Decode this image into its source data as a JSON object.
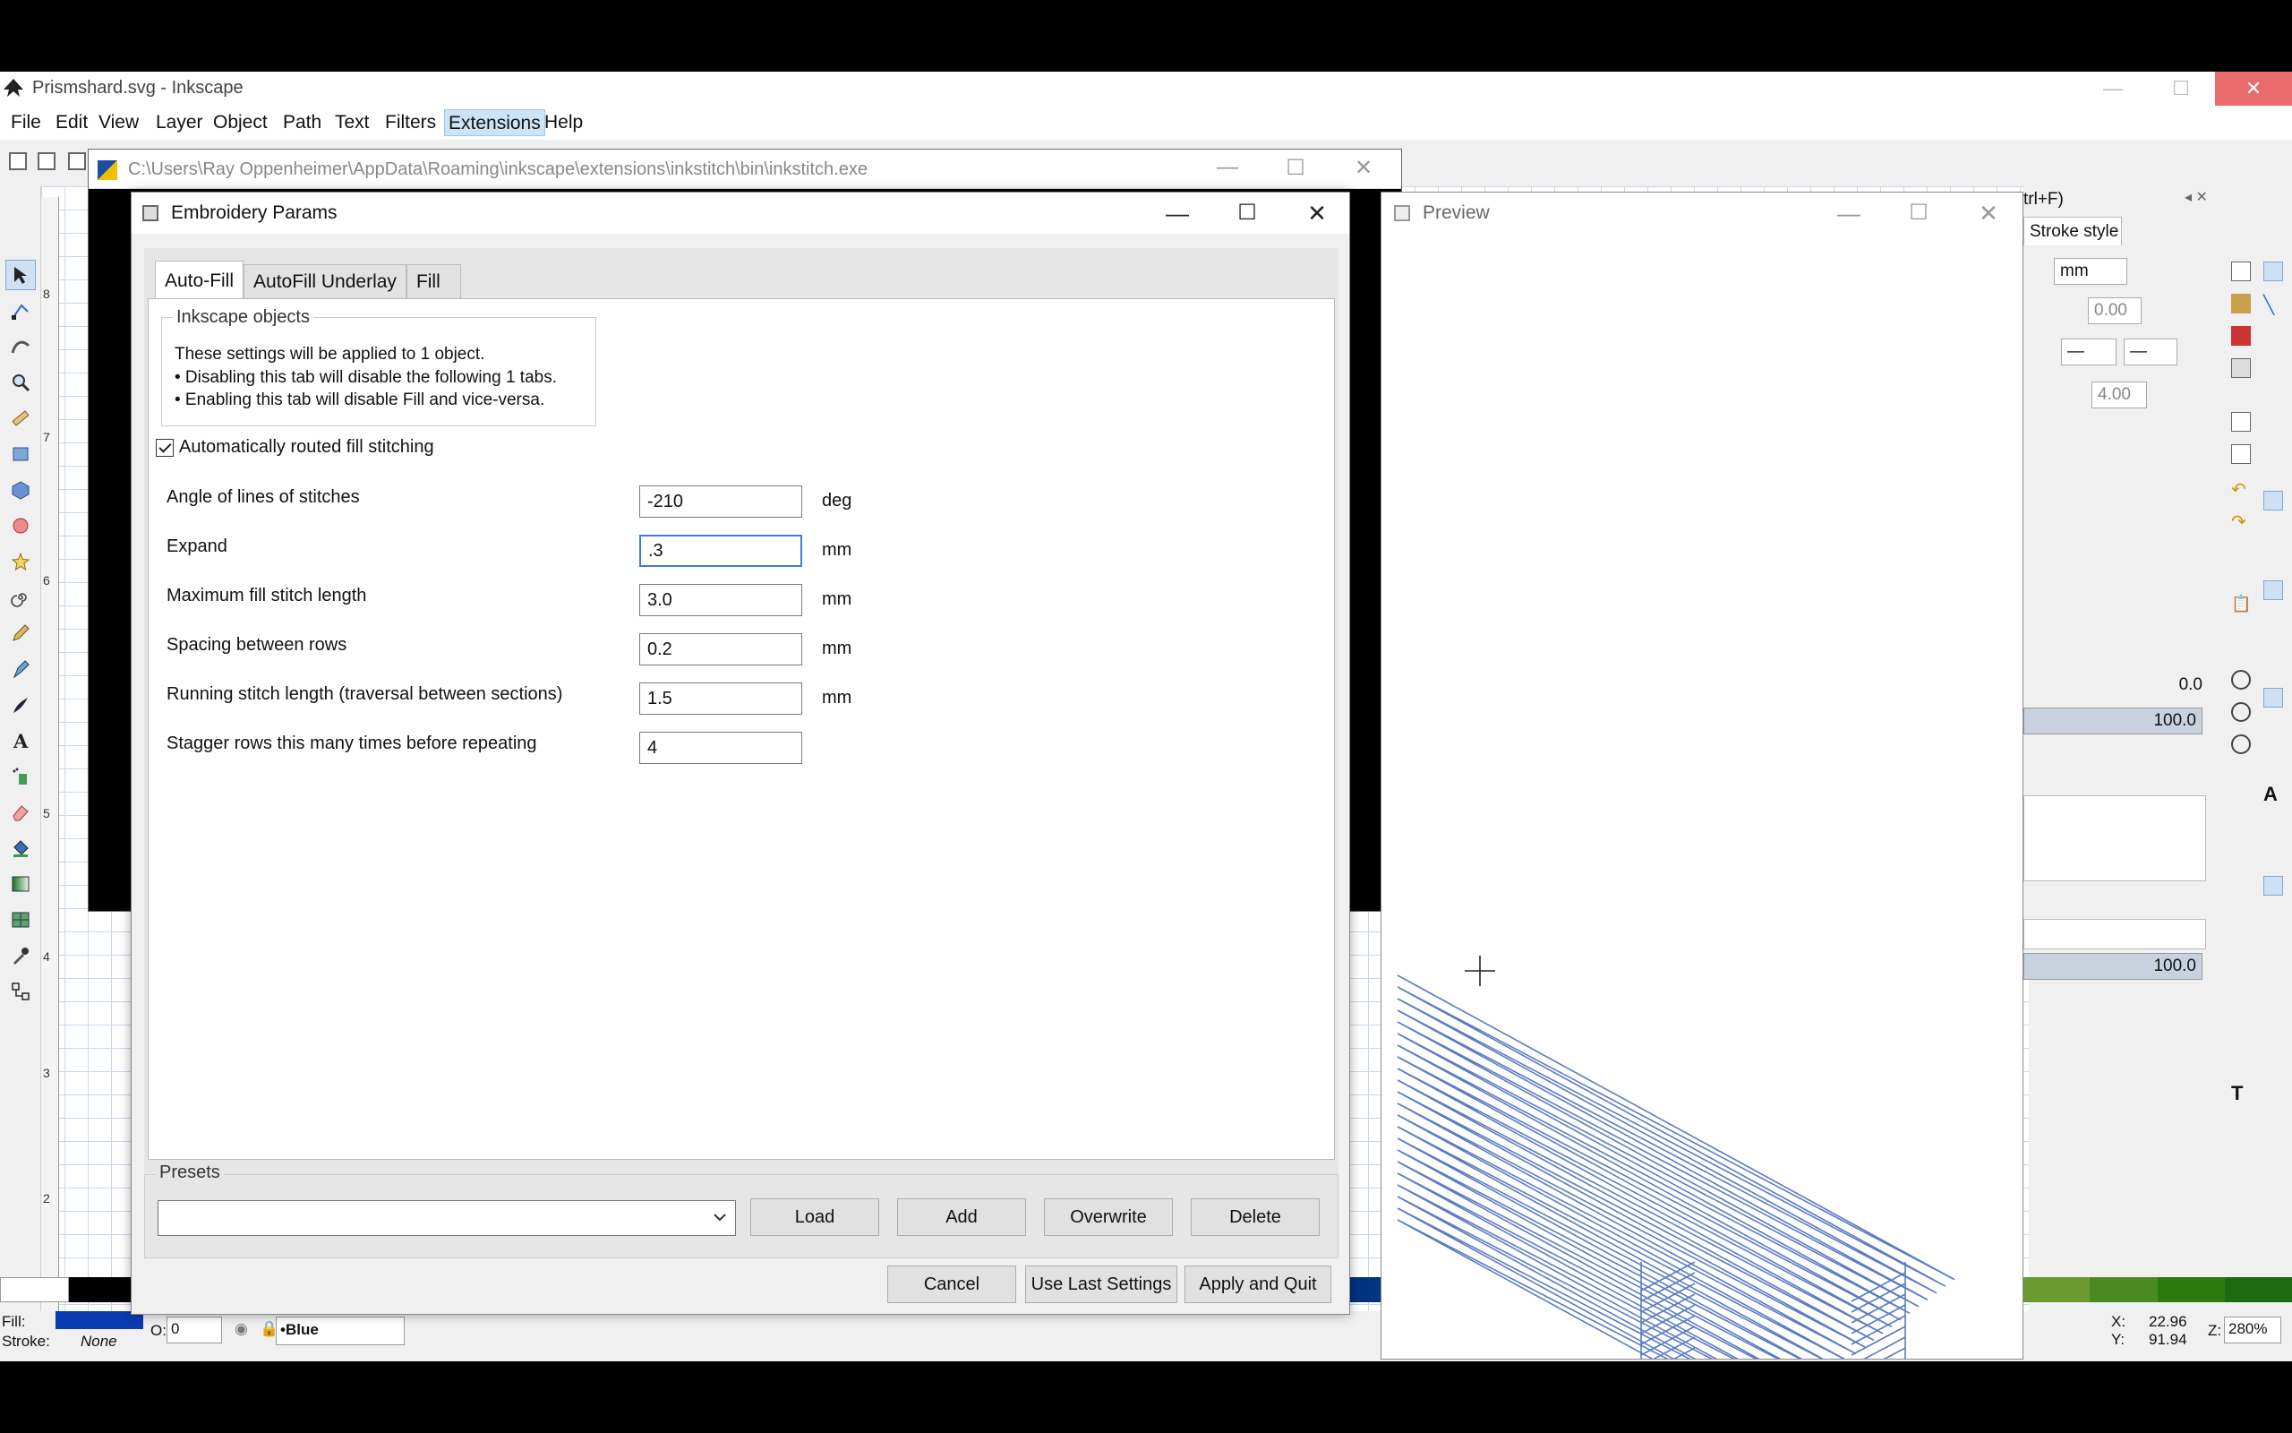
{
  "inkscape": {
    "title": "Prismshard.svg - Inkscape",
    "menu": [
      "File",
      "Edit",
      "View",
      "Layer",
      "Object",
      "Path",
      "Text",
      "Filters",
      "Extensions",
      "Help"
    ],
    "active_menu": "Extensions",
    "ruler_labels": [
      "8",
      "7",
      "6",
      "5",
      "4",
      "3",
      "2"
    ],
    "dock": {
      "search_hint": "trl+F)",
      "tab_stroke_style": "Stroke style",
      "unit": "mm",
      "width_value": "0.00",
      "miter_value": "4.00",
      "blur_value": "0.0",
      "opacity_value": "100.0",
      "opacity_value_2": "100.0"
    },
    "status": {
      "fill_label": "Fill:",
      "stroke_label": "Stroke:",
      "stroke_value": "None",
      "opacity_label": "O:",
      "opacity_value": "0",
      "layer_name": "•Blue",
      "x_label": "X:",
      "x_value": "22.96",
      "y_label": "Y:",
      "y_value": "91.94",
      "zoom_label": "Z:",
      "zoom_value": "280%"
    },
    "colors": {
      "fill_swatch": "#0a3bb0",
      "accent": "#3c7fd6",
      "stitch": "#5b7cc2"
    }
  },
  "console": {
    "path": "C:\\Users\\Ray Oppenheimer\\AppData\\Roaming\\inkscape\\extensions\\inkstitch\\bin\\inkstitch.exe"
  },
  "dialog": {
    "title": "Embroidery Params",
    "tabs": [
      "Auto-Fill",
      "AutoFill Underlay",
      "Fill"
    ],
    "group_title": "Inkscape objects",
    "info": [
      "These settings will be applied to 1 object.",
      "• Disabling this tab will disable the following 1 tabs.",
      "• Enabling this tab will disable Fill and vice-versa."
    ],
    "auto_route_label": "Automatically routed fill stitching",
    "params": [
      {
        "label": "Angle of lines of stitches",
        "value": "-210",
        "unit": "deg"
      },
      {
        "label": "Expand",
        "value": ".3",
        "unit": "mm"
      },
      {
        "label": "Maximum fill stitch length",
        "value": "3.0",
        "unit": "mm"
      },
      {
        "label": "Spacing between rows",
        "value": "0.2",
        "unit": "mm"
      },
      {
        "label": "Running stitch length (traversal between sections)",
        "value": "1.5",
        "unit": "mm"
      },
      {
        "label": "Stagger rows this many times before repeating",
        "value": "4",
        "unit": ""
      }
    ],
    "presets_title": "Presets",
    "preset_value": "",
    "buttons": {
      "load": "Load",
      "add": "Add",
      "overwrite": "Overwrite",
      "delete": "Delete",
      "cancel": "Cancel",
      "use_last": "Use Last Settings",
      "apply": "Apply and Quit"
    }
  },
  "preview": {
    "title": "Preview"
  }
}
